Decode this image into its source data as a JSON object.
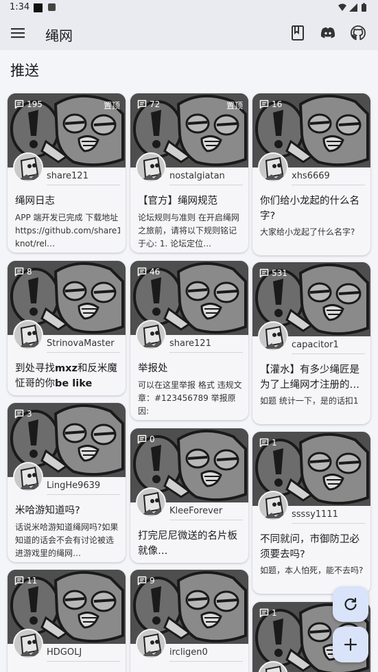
{
  "status": {
    "time": "1:34"
  },
  "app": {
    "title": "绳网",
    "section_title": "推送"
  },
  "icons": {
    "menu": "menu-icon",
    "book": "bookmark-book-icon",
    "discord": "discord-icon",
    "github": "github-icon",
    "comment": "comment-icon",
    "refresh": "refresh-icon",
    "add": "add-icon"
  },
  "posts": [
    {
      "count": "195",
      "pinned": "置顶",
      "author": "share121",
      "title": "绳网日志",
      "excerpt": "APP 端开发已完成 下载地址 https://github.com/share121/inter-knot/rel…"
    },
    {
      "count": "72",
      "pinned": "置顶",
      "author": "nostalgiatan",
      "title": "【官方】绳网规范",
      "excerpt": "论坛规则与准则 在开启绳网之旅前，请将以下规则铭记于心: 1. 论坛定位…"
    },
    {
      "count": "16",
      "author": "xhs6669",
      "title": "你们给小龙起的什么名字?",
      "excerpt": "大家给小龙起了什么名字?"
    },
    {
      "count": "8",
      "author": "StrinovaMaster",
      "title": "到处寻找mxz和反米魔怔哥的你be like",
      "excerpt": ""
    },
    {
      "count": "46",
      "author": "share121",
      "title": "举报处",
      "excerpt": "可以在这里举报 格式 违规文章：#123456789 举报原因:"
    },
    {
      "count": "531",
      "author": "capacitor1",
      "title": "【灌水】有多少绳匠是为了上绳网才注册的…",
      "excerpt": "如题 统计一下，是的话扣1"
    },
    {
      "count": "3",
      "author": "LingHe9639",
      "title": "米哈游知道吗?",
      "excerpt": "话说米哈游知道绳网吗?如果知道的话会不会有讨论被选进游戏里的绳网…"
    },
    {
      "count": "0",
      "author": "KleeForever",
      "title": "打完尼尼微送的名片板就像…",
      "excerpt": ""
    },
    {
      "count": "1",
      "author": "ssssy1111",
      "title": "不同就问，市御防卫必须要去吗?",
      "excerpt": "如题，本人怕死，能不去吗?"
    },
    {
      "count": "11",
      "author": "HDGOLJ",
      "title": "",
      "excerpt": ""
    },
    {
      "count": "9",
      "author": "ircligen0",
      "title": "",
      "excerpt": ""
    },
    {
      "count": "1",
      "author": "",
      "title": "",
      "excerpt": ""
    }
  ],
  "colors": {
    "fab": "#d9e3fa",
    "appbar": "#e9ebf1",
    "background": "#f4f5f9"
  }
}
